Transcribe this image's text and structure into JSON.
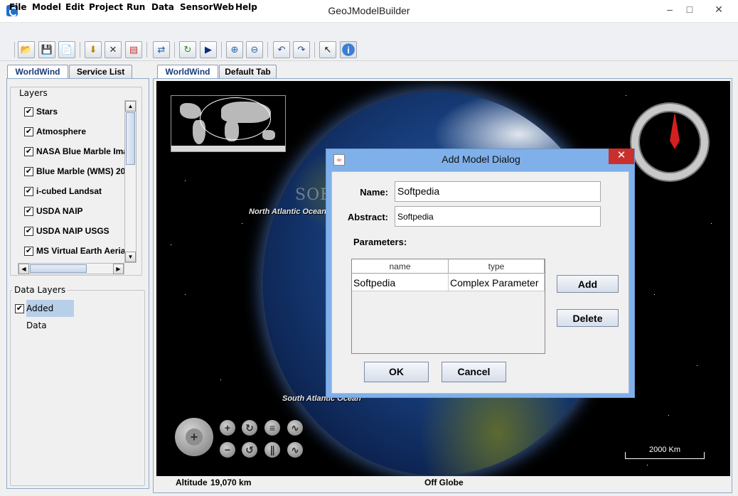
{
  "window": {
    "title": "GeoJModelBuilder",
    "minimize": "–",
    "maximize": "□",
    "close": "✕"
  },
  "menu": [
    "File",
    "Model",
    "Edit",
    "Project",
    "Run",
    "Data",
    "SensorWeb",
    "Help"
  ],
  "toolbar": {
    "icons": [
      "open-folder-icon",
      "save-icon",
      "new-file-icon",
      "import-icon",
      "delete-icon",
      "properties-icon",
      "connect-icon",
      "refresh-icon",
      "run-icon",
      "zoom-in-icon",
      "zoom-out-icon",
      "undo-icon",
      "redo-icon",
      "select-pointer-icon",
      "info-icon"
    ],
    "glyphs": [
      "📂",
      "💾",
      "📄",
      "⬇",
      "✕",
      "▤",
      "⇄",
      "↻",
      "▶",
      "⊕",
      "⊖",
      "↶",
      "↷",
      "↖",
      "i"
    ]
  },
  "left_tabs": [
    "WorldWind",
    "Service List"
  ],
  "layers": {
    "title": "Layers",
    "items": [
      {
        "label": "Stars",
        "checked": true
      },
      {
        "label": "Atmosphere",
        "checked": true
      },
      {
        "label": "NASA Blue Marble Ima",
        "checked": true
      },
      {
        "label": "Blue Marble (WMS) 20",
        "checked": true
      },
      {
        "label": "i-cubed Landsat",
        "checked": true
      },
      {
        "label": "USDA NAIP",
        "checked": true
      },
      {
        "label": "USDA NAIP USGS",
        "checked": true
      },
      {
        "label": "MS Virtual Earth Aeria",
        "checked": true
      }
    ]
  },
  "data_layers": {
    "title": "Data Layers",
    "items": [
      {
        "label": "Added Data",
        "checked": true
      }
    ]
  },
  "check_glyph": "✔",
  "main_tabs": [
    "WorldWind",
    "Default Tab"
  ],
  "map": {
    "watermark": "SOFTPEDIA",
    "north_atlantic": "North Atlantic Ocean",
    "south_atlantic": "South Atlantic Ocean",
    "scale": "2000 Km",
    "nav_glyphs": [
      "+",
      "↻",
      "≡",
      "∿",
      "−",
      "↺",
      "∥",
      "∿"
    ]
  },
  "status": {
    "altitude_label": "Altitude",
    "altitude_value": "19,070 km",
    "globe_state": "Off Globe"
  },
  "dialog": {
    "title": "Add Model Dialog",
    "name_label": "Name:",
    "name_value": "Softpedia",
    "abstract_label": "Abstract:",
    "abstract_value": "Softpedia",
    "parameters_label": "Parameters:",
    "columns": [
      "name",
      "type"
    ],
    "rows": [
      {
        "name": "Softpedia",
        "type": "Complex Parameter"
      }
    ],
    "add_label": "Add",
    "delete_label": "Delete",
    "ok_label": "OK",
    "cancel_label": "Cancel",
    "close_glyph": "✕"
  }
}
